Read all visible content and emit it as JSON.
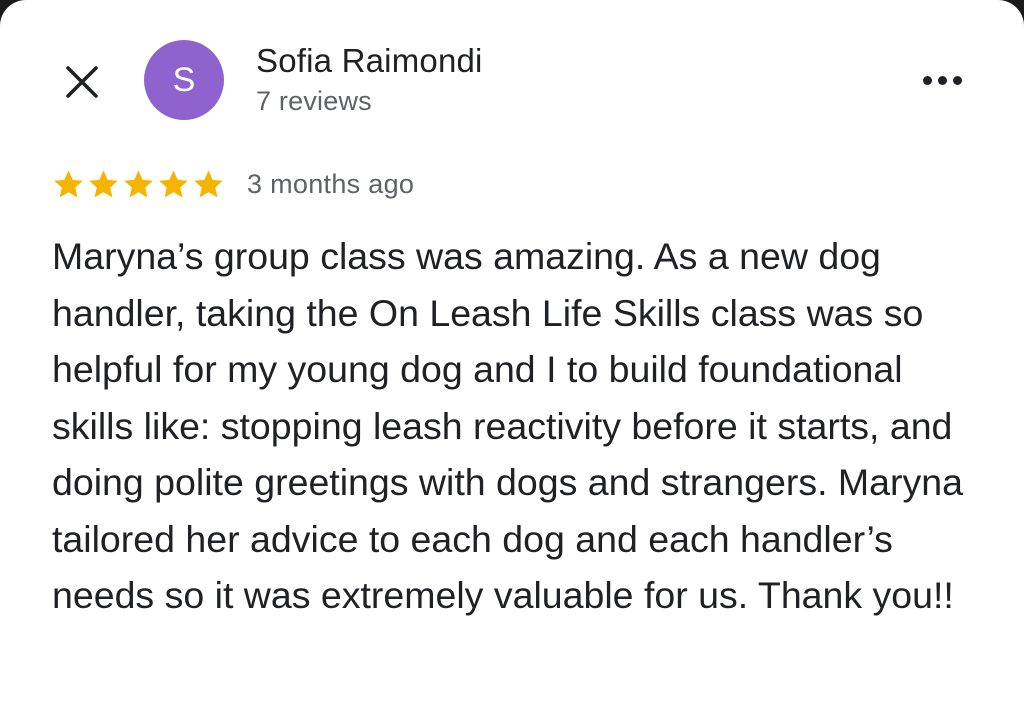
{
  "reviewer": {
    "initial": "S",
    "name": "Sofia Raimondi",
    "review_count": "7 reviews",
    "avatar_color": "#8e63ce"
  },
  "header": {
    "close_icon": "close-icon",
    "more_icon": "more-horizontal-icon"
  },
  "review": {
    "rating": 5,
    "rating_max": 5,
    "star_color": "#f4b400",
    "date": "3 months ago",
    "text": "Maryna’s group class was amazing. As a new dog handler, taking the On Leash Life Skills class was so helpful for my young dog and I to build foundational skills like: stopping leash reactivity before it starts, and doing polite greetings with dogs and strangers. Maryna tailored her advice to each dog and each handler’s needs so it was extremely valuable for us. Thank you!!"
  }
}
